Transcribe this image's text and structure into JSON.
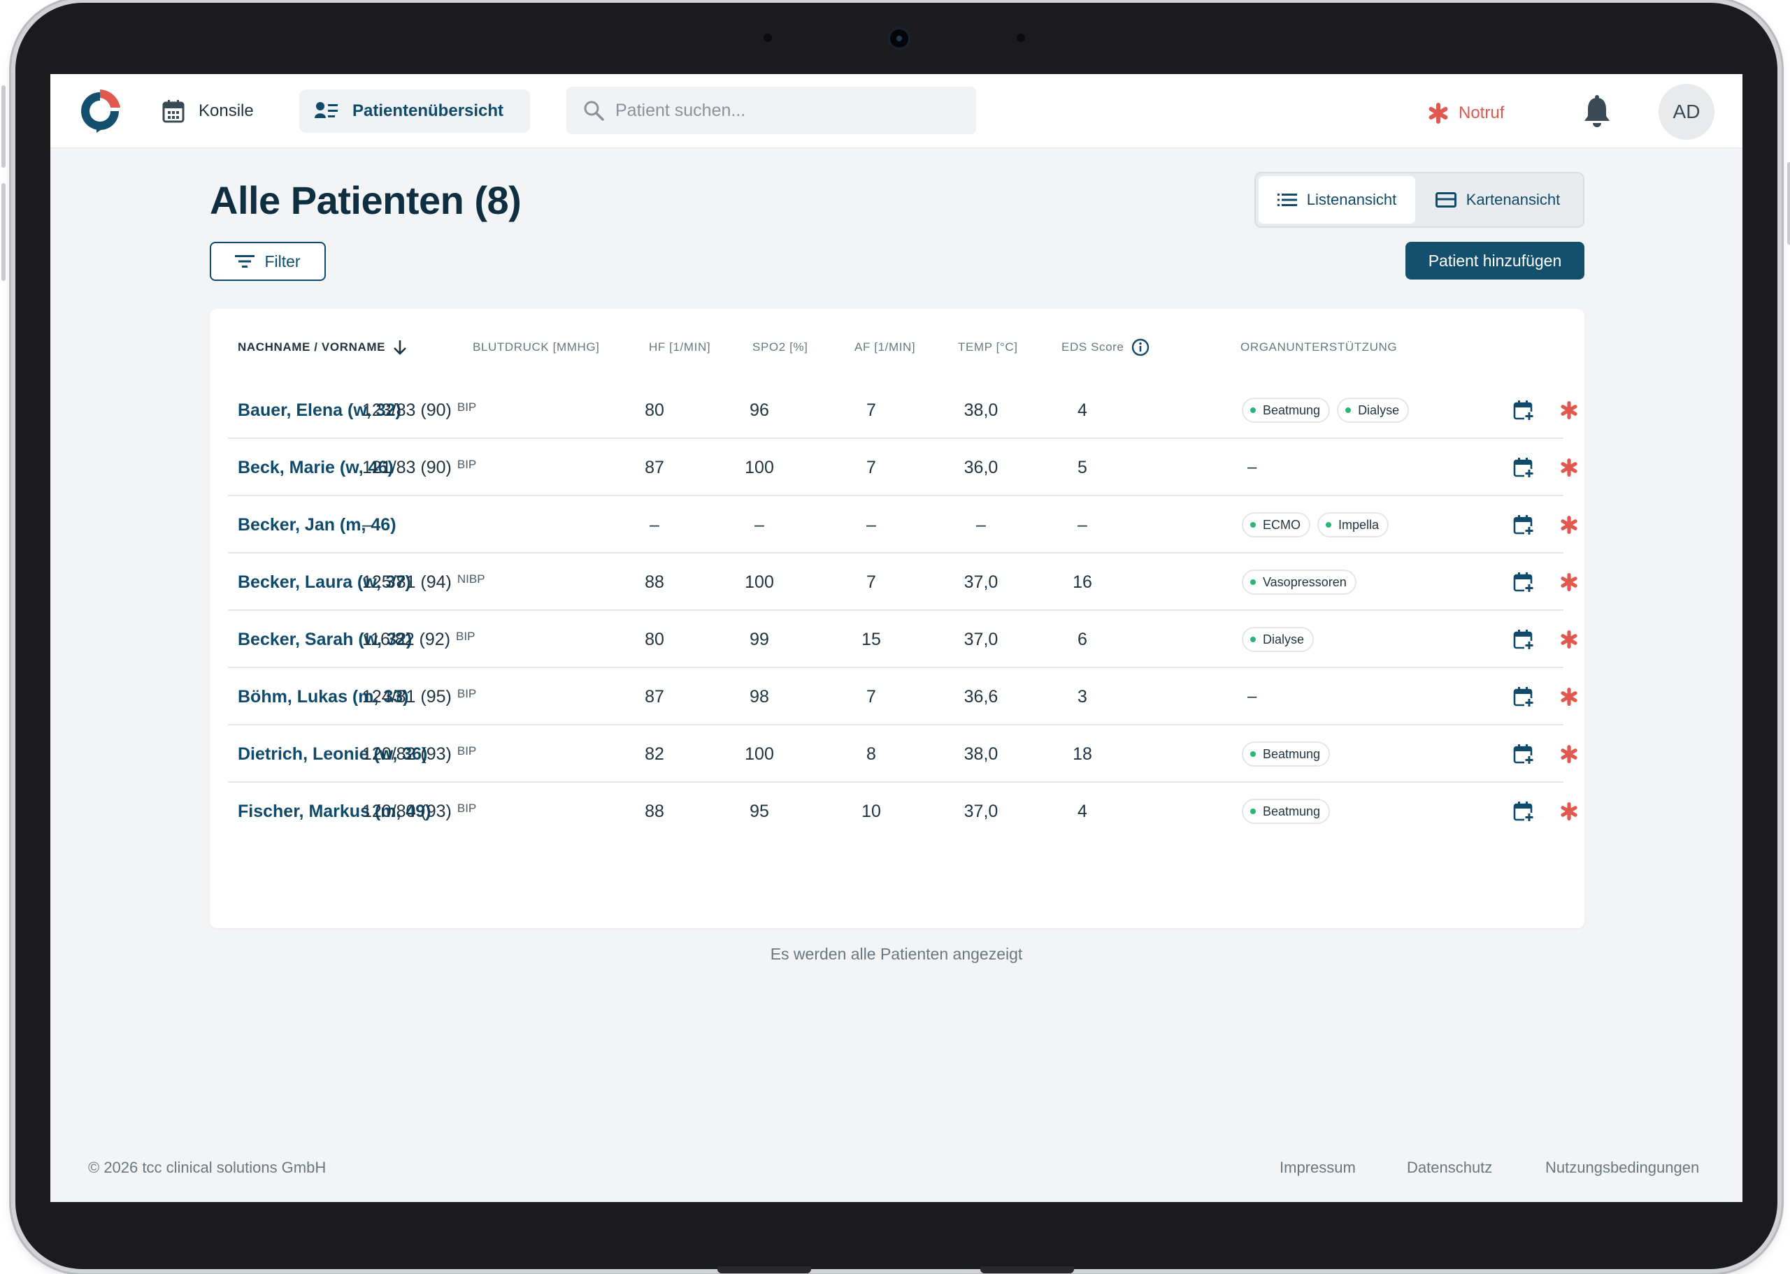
{
  "header": {
    "nav": [
      {
        "label": "Konsile",
        "icon": "calendar-icon"
      },
      {
        "label": "Patientenübersicht",
        "icon": "patients-icon",
        "active": true
      }
    ],
    "search_placeholder": "Patient suchen...",
    "notruf_label": "Notruf",
    "avatar_initials": "AD"
  },
  "page": {
    "title": "Alle Patienten (8)",
    "filter_label": "Filter",
    "view_list_label": "Listenansicht",
    "view_cards_label": "Kartenansicht",
    "add_patient_label": "Patient hinzufügen"
  },
  "table": {
    "columns": {
      "name": "NACHNAME / VORNAME",
      "bp": "BLUTDRUCK [MMHG]",
      "hf": "HF [1/MIN]",
      "spo2": "SPO2 [%]",
      "af": "AF [1/MIN]",
      "temp": "TEMP [°C]",
      "eds": "EDS Score",
      "organ": "ORGANUNTERSTÜTZUNG"
    },
    "rows": [
      {
        "name": "Bauer, Elena (w, 32)",
        "bp": "123/83 (90)",
        "bp_tag": "BIP",
        "hf": "80",
        "spo2": "96",
        "af": "7",
        "temp": "38,0",
        "eds": "4",
        "organ": [
          "Beatmung",
          "Dialyse"
        ]
      },
      {
        "name": "Beck, Marie (w, 46)",
        "bp": "121/83 (90)",
        "bp_tag": "BIP",
        "hf": "87",
        "spo2": "100",
        "af": "7",
        "temp": "36,0",
        "eds": "5",
        "organ": []
      },
      {
        "name": "Becker, Jan (m, 46)",
        "bp": "–",
        "bp_tag": "",
        "hf": "–",
        "spo2": "–",
        "af": "–",
        "temp": "–",
        "eds": "–",
        "organ": [
          "ECMO",
          "Impella"
        ]
      },
      {
        "name": "Becker, Laura (w, 37)",
        "bp": "125/81 (94)",
        "bp_tag": "NIBP",
        "hf": "88",
        "spo2": "100",
        "af": "7",
        "temp": "37,0",
        "eds": "16",
        "organ": [
          "Vasopressoren"
        ]
      },
      {
        "name": "Becker, Sarah (w, 32)",
        "bp": "116/82 (92)",
        "bp_tag": "BIP",
        "hf": "80",
        "spo2": "99",
        "af": "15",
        "temp": "37,0",
        "eds": "6",
        "organ": [
          "Dialyse"
        ]
      },
      {
        "name": "Böhm, Lukas (m, 33)",
        "bp": "124/81 (95)",
        "bp_tag": "BIP",
        "hf": "87",
        "spo2": "98",
        "af": "7",
        "temp": "36,6",
        "eds": "3",
        "organ": []
      },
      {
        "name": "Dietrich, Leonie (w, 36)",
        "bp": "120/82 (93)",
        "bp_tag": "BIP",
        "hf": "82",
        "spo2": "100",
        "af": "8",
        "temp": "38,0",
        "eds": "18",
        "organ": [
          "Beatmung"
        ]
      },
      {
        "name": "Fischer, Markus (m, 49)",
        "bp": "120/80 (93)",
        "bp_tag": "BIP",
        "hf": "88",
        "spo2": "95",
        "af": "10",
        "temp": "37,0",
        "eds": "4",
        "organ": [
          "Beatmung"
        ]
      }
    ],
    "empty_organ": "–"
  },
  "footnote": "Es werden alle Patienten angezeigt",
  "footer": {
    "copyright": "© 2026 tcc clinical solutions GmbH",
    "links": [
      "Impressum",
      "Datenschutz",
      "Nutzungsbedingungen"
    ]
  },
  "colors": {
    "brand": "#14506d",
    "accent_red": "#e0584f",
    "chip_dot": "#2bb673"
  }
}
